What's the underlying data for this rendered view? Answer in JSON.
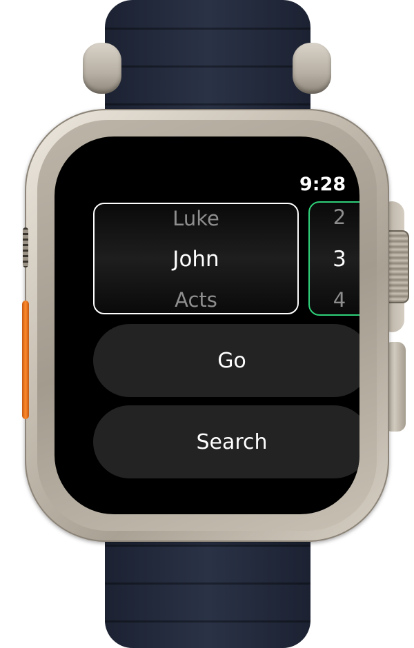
{
  "status_bar": {
    "time": "9:28"
  },
  "book_picker": {
    "items": [
      "Luke",
      "John",
      "Acts"
    ],
    "selected": "John"
  },
  "chapter_picker": {
    "items": [
      "2",
      "3",
      "4"
    ],
    "selected": "3",
    "accent_color": "#2fd17a"
  },
  "buttons": {
    "go_label": "Go",
    "search_label": "Search"
  },
  "colors": {
    "screen_background": "#000000",
    "button_background": "#232323",
    "action_button": "#ff8a2a",
    "band": "#1f2638"
  }
}
